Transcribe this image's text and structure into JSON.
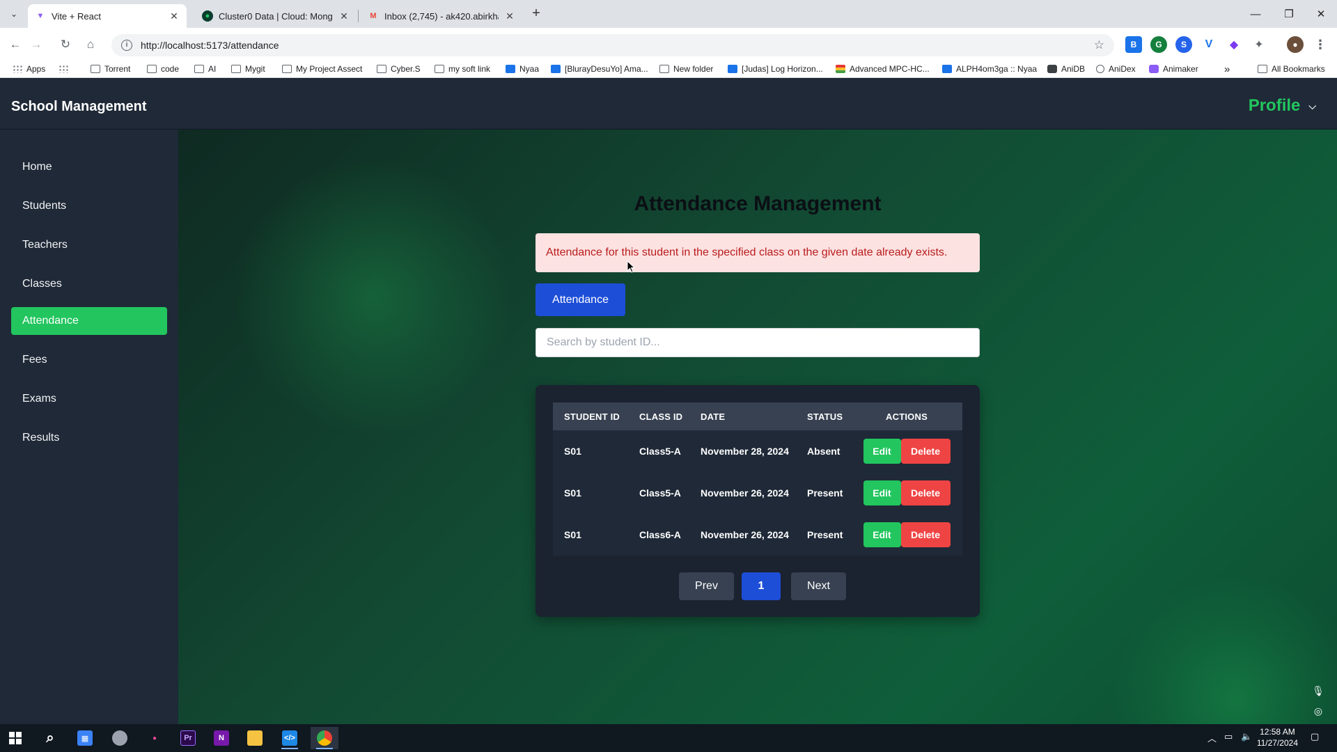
{
  "browser": {
    "tabs": [
      {
        "title": "Vite + React",
        "active": true
      },
      {
        "title": "Cluster0 Data | Cloud: MongoD",
        "active": false
      },
      {
        "title": "Inbox (2,745) - ak420.abirkhan",
        "active": false
      }
    ],
    "url": "http://localhost:5173/attendance",
    "bookmarks": [
      "Apps",
      "Torrent",
      "code",
      "AI",
      "Mygit",
      "My Project Assect",
      "Cyber.S",
      "my soft link",
      "Nyaa",
      "[BlurayDesuYo] Ama...",
      "New folder",
      "[Judas] Log Horizon...",
      "Advanced MPC-HC...",
      "ALPH4om3ga :: Nyaa",
      "AniDB",
      "AniDex",
      "Animaker"
    ],
    "all_bookmarks": "All Bookmarks",
    "more_bookmarks": "»"
  },
  "app": {
    "brand": "School Management",
    "profile_label": "Profile",
    "sidebar": [
      {
        "label": "Home",
        "active": false
      },
      {
        "label": "Students",
        "active": false
      },
      {
        "label": "Teachers",
        "active": false
      },
      {
        "label": "Classes",
        "active": false
      },
      {
        "label": "Attendance",
        "active": true
      },
      {
        "label": "Fees",
        "active": false
      },
      {
        "label": "Exams",
        "active": false
      },
      {
        "label": "Results",
        "active": false
      }
    ]
  },
  "main": {
    "title": "Attendance Management",
    "alert": "Attendance for this student in the specified class on the given date already exists.",
    "attendance_button": "Attendance",
    "search_placeholder": "Search by student ID...",
    "search_value": "",
    "table": {
      "headers": [
        "STUDENT ID",
        "CLASS ID",
        "DATE",
        "STATUS",
        "ACTIONS"
      ],
      "rows": [
        {
          "student_id": "S01",
          "class_id": "Class5-A",
          "date": "November 28, 2024",
          "status": "Absent"
        },
        {
          "student_id": "S01",
          "class_id": "Class5-A",
          "date": "November 26, 2024",
          "status": "Present"
        },
        {
          "student_id": "S01",
          "class_id": "Class6-A",
          "date": "November 26, 2024",
          "status": "Present"
        }
      ],
      "edit_label": "Edit",
      "delete_label": "Delete"
    },
    "pagination": {
      "prev": "Prev",
      "page": "1",
      "next": "Next"
    }
  },
  "taskbar": {
    "time": "12:58 AM",
    "date": "11/27/2024"
  },
  "colors": {
    "accent_green": "#22c55e",
    "primary_blue": "#1d4ed8",
    "danger_red": "#ef4444",
    "alert_bg": "#fde2e2",
    "alert_text": "#b91c1c",
    "sidebar_bg": "#1f2937"
  }
}
